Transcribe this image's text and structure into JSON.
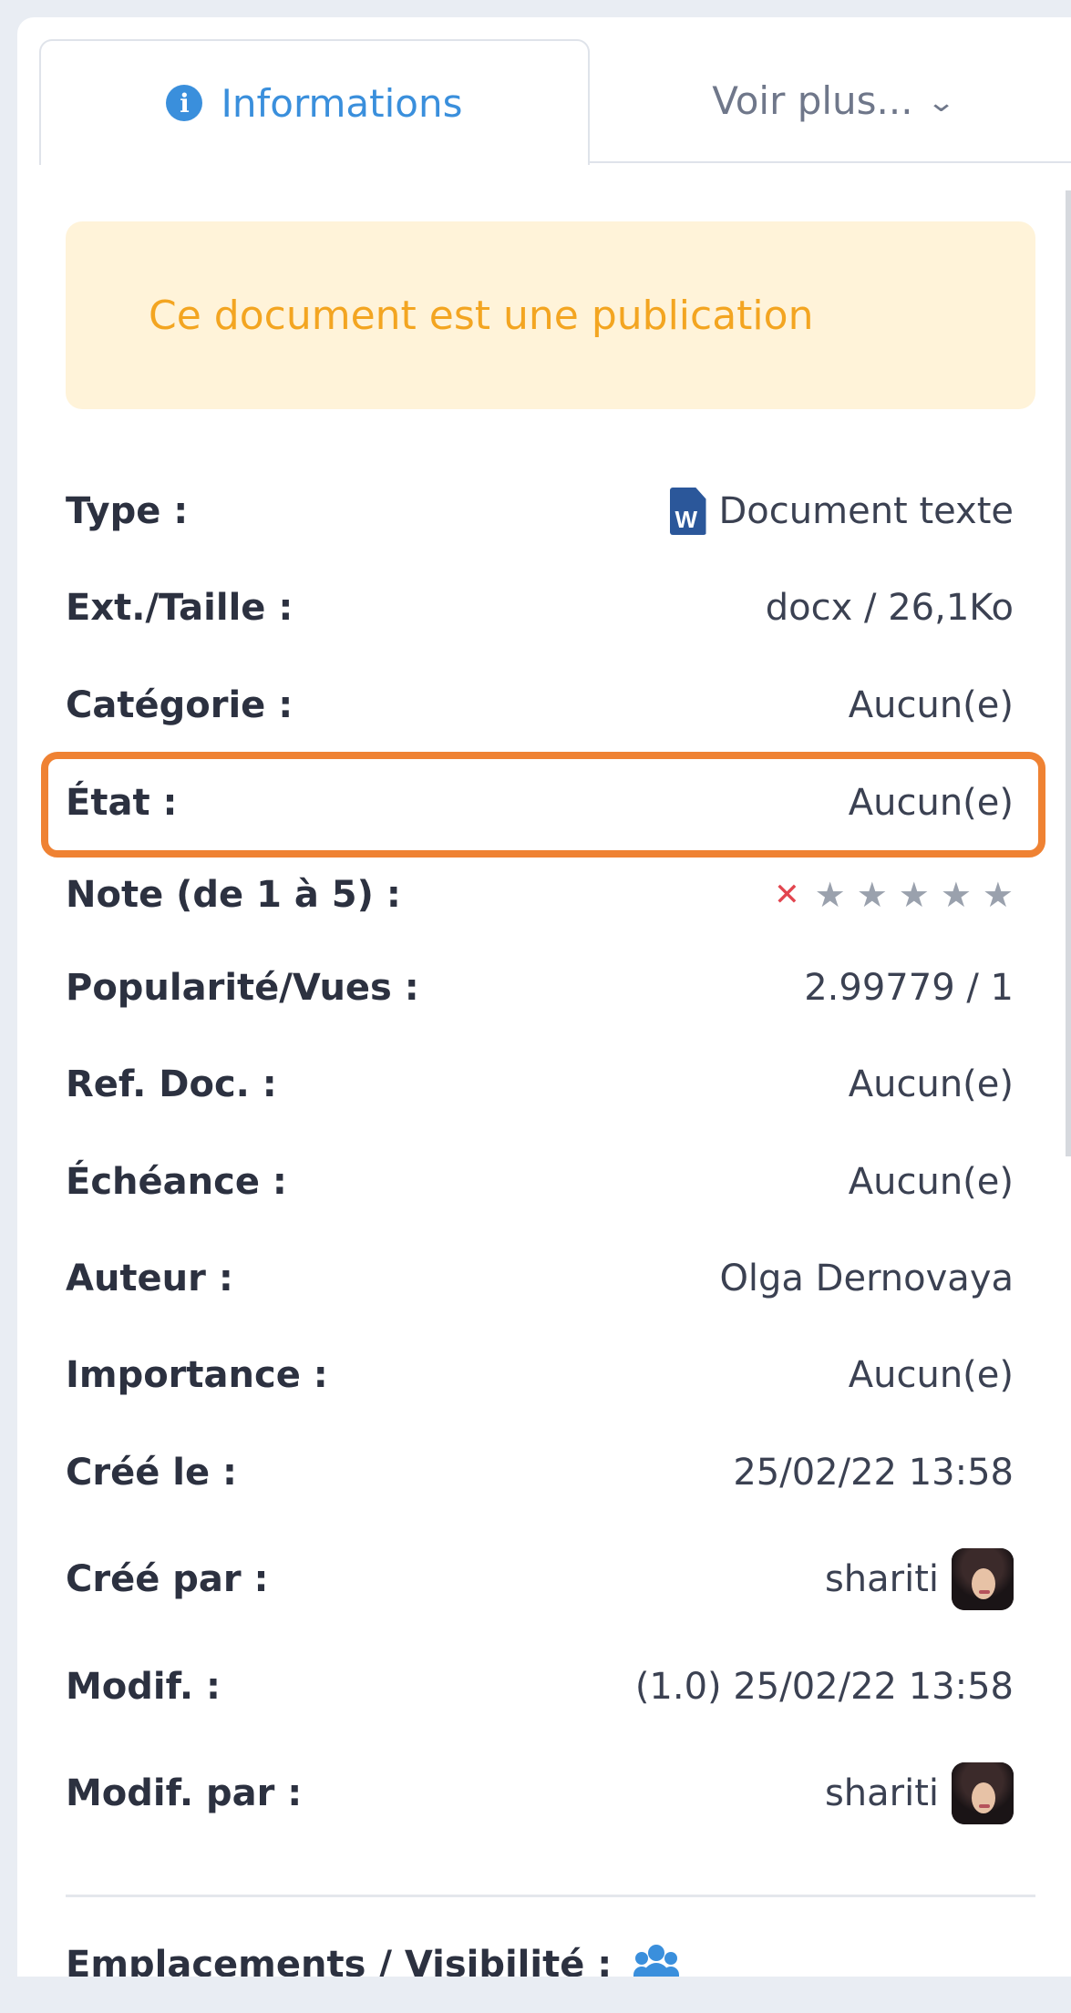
{
  "tabs": {
    "informations": "Informations",
    "voir_plus": "Voir plus..."
  },
  "notice": "Ce document est une publication",
  "fields": {
    "type": {
      "label": "Type :",
      "value": "Document texte",
      "icon": "word-document-icon"
    },
    "ext_taille": {
      "label": "Ext./Taille :",
      "value": "docx / 26,1Ko"
    },
    "categorie": {
      "label": "Catégorie :",
      "value": "Aucun(e)"
    },
    "etat": {
      "label": "État :",
      "value": "Aucun(e)"
    },
    "note": {
      "label": "Note (de 1 à 5) :",
      "rating": 0,
      "max": 5
    },
    "popularite": {
      "label": "Popularité/Vues :",
      "value": "2.99779 / 1"
    },
    "ref_doc": {
      "label": "Ref. Doc. :",
      "value": "Aucun(e)"
    },
    "echeance": {
      "label": "Échéance :",
      "value": "Aucun(e)"
    },
    "auteur": {
      "label": "Auteur :",
      "value": "Olga Dernovaya"
    },
    "importance": {
      "label": "Importance :",
      "value": "Aucun(e)"
    },
    "cree_le": {
      "label": "Créé le :",
      "value": "25/02/22 13:58"
    },
    "cree_par": {
      "label": "Créé par :",
      "value": "shariti"
    },
    "modif": {
      "label": "Modif. :",
      "value": "(1.0) 25/02/22 13:58"
    },
    "modif_par": {
      "label": "Modif. par :",
      "value": "shariti"
    }
  },
  "emplacements": {
    "label": "Emplacements / Visibilité :"
  },
  "colors": {
    "accent": "#3a8fdc",
    "notice_bg": "#fff3d9",
    "notice_text": "#f3a521",
    "highlight": "#ef8233",
    "clear_rating": "#e2454f"
  }
}
